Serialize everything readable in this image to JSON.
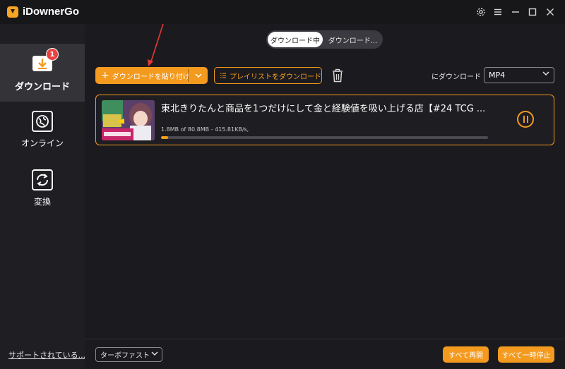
{
  "app": {
    "title": "iDownerGo"
  },
  "sidebar": {
    "items": [
      {
        "label": "ダウンロード",
        "icon": "download-icon",
        "badge": "1",
        "active": true
      },
      {
        "label": "オンライン",
        "icon": "globe-icon",
        "active": false
      },
      {
        "label": "変換",
        "icon": "convert-icon",
        "active": false
      }
    ],
    "support_link": "サポートされている..."
  },
  "tabs": [
    {
      "label": "ダウンロード中",
      "active": true
    },
    {
      "label": "ダウンロード...",
      "active": false
    }
  ],
  "toolbar": {
    "paste_label": "ダウンロードを貼り付け",
    "playlist_label": "プレイリストをダウンロード",
    "format_prefix": "にダウンロード",
    "format_value": "MP4"
  },
  "downloads": [
    {
      "title": "東北きりたんと商品を1つだけにして金と経験値を吸い上げる店【#24 TCG ...",
      "progress_text": "1.8MB of 80.8MB -  415.81KB/s,",
      "progress": 0.022
    }
  ],
  "footer": {
    "turbo_label": "ターボファスト",
    "resume_all": "すべて再開",
    "pause_all": "すべて一時停止"
  },
  "colors": {
    "accent": "#f39a1f",
    "badge": "#e94040",
    "annotation_arrow": "#e53935"
  }
}
